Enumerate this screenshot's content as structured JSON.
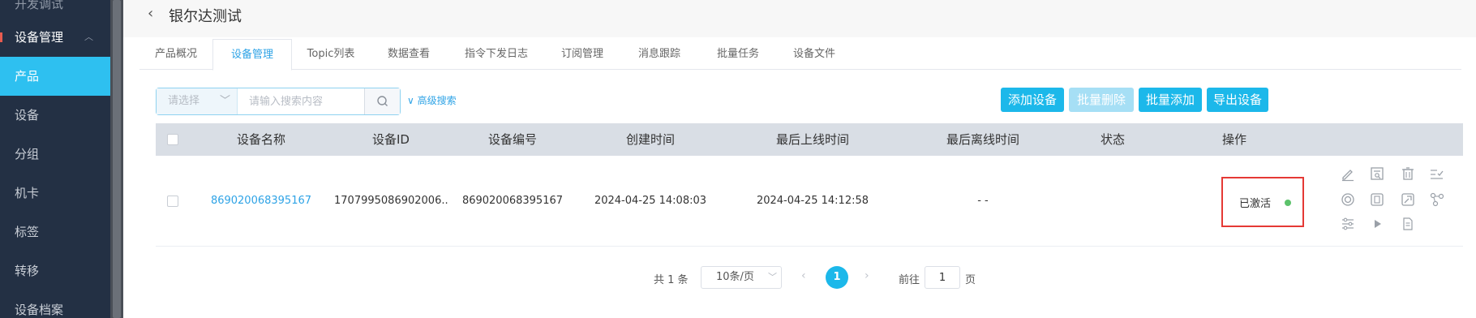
{
  "sidebar": {
    "partial_item": "开发调试",
    "group_label": "设备管理",
    "items": [
      {
        "label": "产品",
        "active": true
      },
      {
        "label": "设备",
        "active": false
      },
      {
        "label": "分组",
        "active": false
      },
      {
        "label": "机卡",
        "active": false
      },
      {
        "label": "标签",
        "active": false
      },
      {
        "label": "转移",
        "active": false
      },
      {
        "label": "设备档案",
        "active": false
      }
    ]
  },
  "header": {
    "title": "银尔达测试"
  },
  "tabs": [
    {
      "label": "产品概况",
      "active": false
    },
    {
      "label": "设备管理",
      "active": true
    },
    {
      "label": "Topic列表",
      "active": false
    },
    {
      "label": "数据查看",
      "active": false
    },
    {
      "label": "指令下发日志",
      "active": false
    },
    {
      "label": "订阅管理",
      "active": false
    },
    {
      "label": "消息跟踪",
      "active": false
    },
    {
      "label": "批量任务",
      "active": false
    },
    {
      "label": "设备文件",
      "active": false
    }
  ],
  "search": {
    "select_placeholder": "请选择",
    "input_placeholder": "请输入搜索内容",
    "advanced_label": "高级搜索"
  },
  "toolbar": {
    "add_label": "添加设备",
    "batch_delete_label": "批量删除",
    "batch_add_label": "批量添加",
    "export_label": "导出设备"
  },
  "table": {
    "headers": [
      "设备名称",
      "设备ID",
      "设备编号",
      "创建时间",
      "最后上线时间",
      "最后离线时间",
      "状态",
      "操作"
    ],
    "rows": [
      {
        "name": "869020068395167",
        "id": "1707995086902006...",
        "number": "869020068395167",
        "created": "2024-04-25 14:08:03",
        "last_online": "2024-04-25 14:12:58",
        "last_offline": "- -",
        "status": "已激活"
      }
    ]
  },
  "actions": [
    "edit-icon",
    "view-detail-icon",
    "delete-icon",
    "checklist-icon",
    "settings-icon",
    "storage-icon",
    "debug-icon",
    "topology-icon",
    "filter-icon",
    "play-icon",
    "document-icon"
  ],
  "pagination": {
    "total": "共 1 条",
    "page_size": "10条/页",
    "current_page": "1",
    "goto_label": "前往",
    "goto_value": "1",
    "page_suffix": "页"
  },
  "colors": {
    "sidebar_bg": "#233044",
    "accent": "#1cb8ea",
    "active_status": "#5cc26b",
    "highlight_border": "#e53935"
  }
}
